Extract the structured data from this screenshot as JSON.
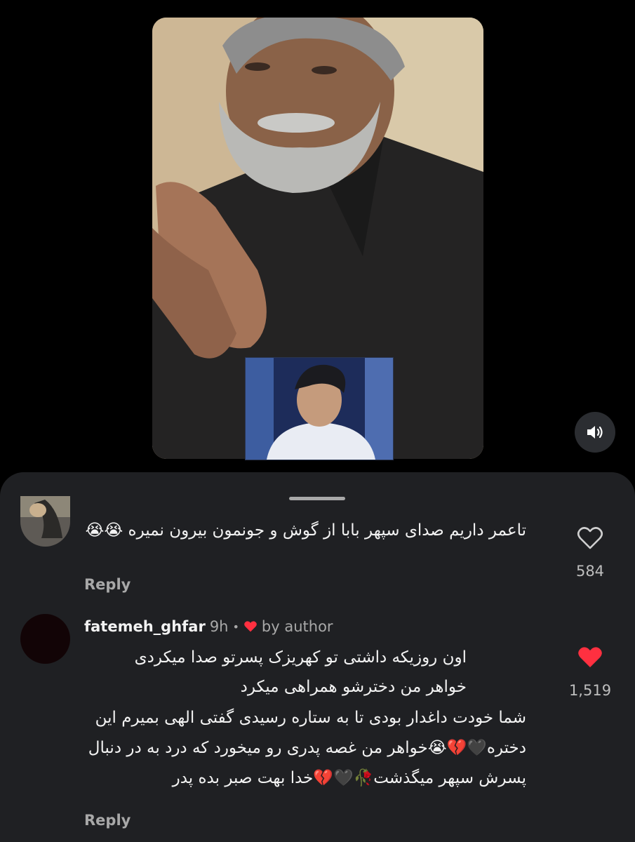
{
  "video": {
    "sound_icon": "speaker-icon"
  },
  "comments": [
    {
      "username": "",
      "text": "تاعمر داریم صدای سپهر بابا از گوش و جونمون بیرون نمیره 😭😭",
      "reply_label": "Reply",
      "like_count": "584",
      "liked": false
    },
    {
      "username": "fatemeh_ghfar",
      "time": "9h",
      "by_author_label": "by author",
      "lines": [
        "اون روزیکه داشتی تو کهریزک پسرتو صدا میکردی",
        "خواهر من دخترشو همراهی میکرد",
        "شما خودت داغدار بودی تا به ستاره رسیدی گفتی الهی بمیرم این دختره🖤💔😭خواهر من غصه پدری رو میخورد که درد به در دنبال پسرش سپهر میگذشت🥀🖤💔خدا بهت صبر بده پدر"
      ],
      "reply_label": "Reply",
      "like_count": "1,519",
      "liked": true
    }
  ],
  "colors": {
    "sheet_bg": "#1f2023",
    "like_red": "#ff3040",
    "muted_text": "#a8a8a8"
  }
}
